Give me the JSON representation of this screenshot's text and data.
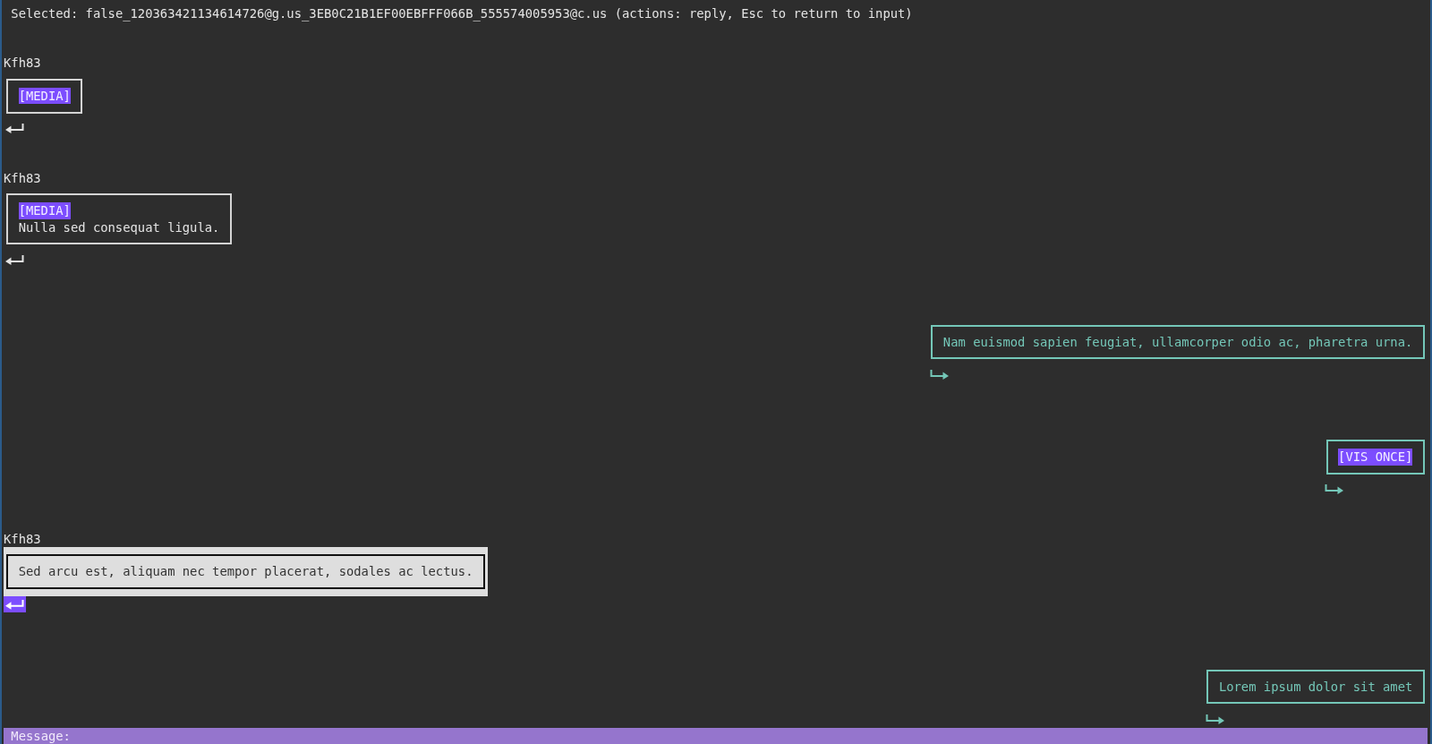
{
  "status_line": "Selected: false_120363421134614726@g.us_3EB0C21B1EF00EBFFF066B_555574005953@c.us (actions: reply, Esc to return to input)",
  "messages": [
    {
      "kind": "incoming",
      "sender": "Kfh83",
      "selected": false,
      "parts": [
        {
          "kind": "tag",
          "text": "[MEDIA]"
        }
      ]
    },
    {
      "kind": "incoming",
      "sender": "Kfh83",
      "selected": false,
      "parts": [
        {
          "kind": "tag",
          "text": "[MEDIA]"
        },
        {
          "kind": "text",
          "text": "Nulla sed consequat ligula."
        }
      ]
    },
    {
      "kind": "outgoing",
      "selected": false,
      "parts": [
        {
          "kind": "text",
          "text": "Nam euismod sapien feugiat, ullamcorper odio ac, pharetra urna."
        }
      ]
    },
    {
      "kind": "outgoing",
      "selected": false,
      "parts": [
        {
          "kind": "tag",
          "text": "[VIS ONCE]"
        }
      ]
    },
    {
      "kind": "incoming",
      "sender": "Kfh83",
      "selected": true,
      "parts": [
        {
          "kind": "text",
          "text": "Sed arcu est, aliquam nec tempor placerat, sodales ac lectus."
        }
      ]
    },
    {
      "kind": "outgoing",
      "selected": false,
      "parts": [
        {
          "kind": "text",
          "text": "Lorem ipsum dolor sit amet"
        }
      ]
    }
  ],
  "input_bar": {
    "prompt": "Message:"
  }
}
